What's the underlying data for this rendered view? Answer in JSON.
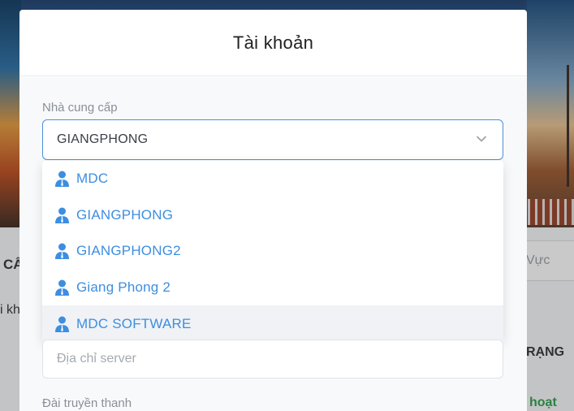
{
  "background": {
    "left_label": "CẤ",
    "left_text": "i kh",
    "search_placeholder": "Vực",
    "table_header": "RẠNG",
    "status_text": "hoạt độ"
  },
  "modal": {
    "title": "Tài khoản",
    "provider_label": "Nhà cung cấp",
    "provider_selected": "GIANGPHONG",
    "provider_options": [
      {
        "label": "MDC",
        "icon": "user-icon"
      },
      {
        "label": "GIANGPHONG",
        "icon": "user-icon"
      },
      {
        "label": "GIANGPHONG2",
        "icon": "user-icon"
      },
      {
        "label": "Giang Phong 2",
        "icon": "user-icon"
      },
      {
        "label": "MDC SOFTWARE",
        "icon": "user-icon"
      }
    ],
    "server_placeholder": "Địa chỉ server",
    "station_label": "Đài truyền thanh"
  },
  "colors": {
    "accent": "#4a90d9",
    "option_text": "#3d8ee0",
    "status_green": "#2e9e4a"
  }
}
